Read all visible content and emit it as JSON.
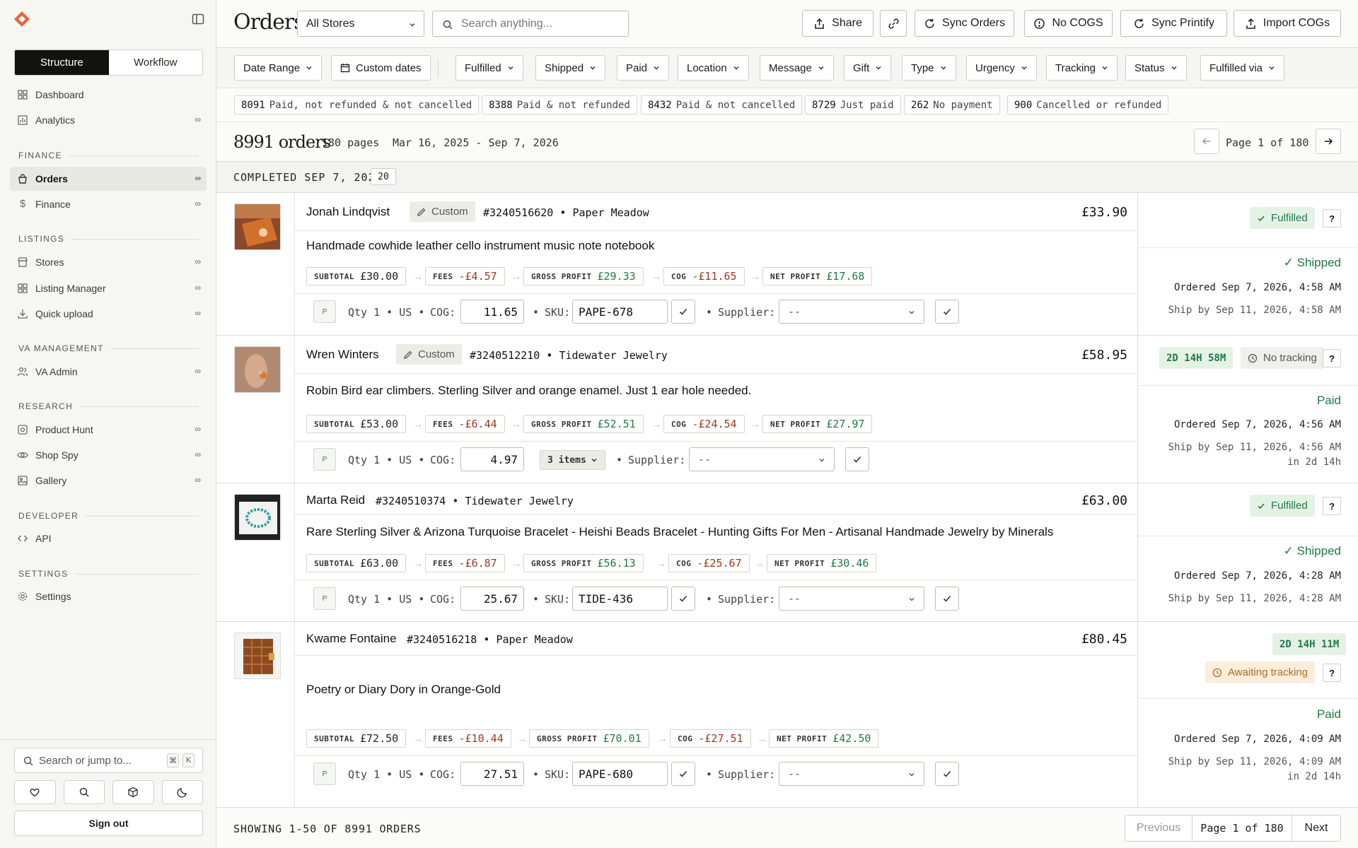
{
  "sidebar": {
    "tabs": [
      "Structure",
      "Workflow"
    ],
    "items": [
      {
        "label": "Dashboard"
      },
      {
        "label": "Analytics",
        "badge": "∞"
      },
      {
        "label": "Orders",
        "badge": "∞"
      },
      {
        "label": "Finance",
        "badge": "∞"
      },
      {
        "label": "Stores",
        "badge": "∞"
      },
      {
        "label": "Listing Manager",
        "badge": "∞"
      },
      {
        "label": "Quick upload",
        "badge": "∞"
      },
      {
        "label": "VA Admin",
        "badge": "∞"
      },
      {
        "label": "Product Hunt",
        "badge": "∞"
      },
      {
        "label": "Shop Spy",
        "badge": "∞"
      },
      {
        "label": "Gallery",
        "badge": "∞"
      },
      {
        "label": "API"
      },
      {
        "label": "Settings"
      }
    ],
    "sections": [
      "FINANCE",
      "LISTINGS",
      "VA MANAGEMENT",
      "RESEARCH",
      "DEVELOPER",
      "SETTINGS"
    ],
    "search_placeholder": "Search or jump to...",
    "kbd": [
      "⌘",
      "K"
    ],
    "sign_out": "Sign out"
  },
  "header": {
    "title": "Orders",
    "store_select": "All Stores",
    "search_placeholder": "Search anything...",
    "share": "Share",
    "sync_orders": "Sync Orders",
    "no_cogs": "No COGS",
    "sync_printify": "Sync Printify",
    "import_cogs": "Import COGs"
  },
  "filters": [
    "Date Range",
    "Custom dates",
    "Fulfilled",
    "Shipped",
    "Paid",
    "Location",
    "Message",
    "Gift",
    "Type",
    "Urgency",
    "Tracking",
    "Status",
    "Fulfilled via"
  ],
  "stats": [
    {
      "count": "8091",
      "label": "Paid, not refunded & not cancelled"
    },
    {
      "count": "8388",
      "label": "Paid & not refunded"
    },
    {
      "count": "8432",
      "label": "Paid & not cancelled"
    },
    {
      "count": "8729",
      "label": "Just paid"
    },
    {
      "count": "262",
      "label": "No payment"
    },
    {
      "count": "900",
      "label": "Cancelled or refunded"
    }
  ],
  "summary": {
    "orders": "8991 orders",
    "pages": "180 pages",
    "date_range": "Mar 16, 2025 - Sep 7, 2026",
    "page_label": "Page 1 of 180"
  },
  "group": {
    "label": "COMPLETED SEP 7, 2026",
    "count": "20"
  },
  "labels": {
    "subtotal": "SUBTOTAL",
    "fees": "FEES",
    "gross": "GROSS PROFIT",
    "cog": "COG",
    "net": "NET PROFIT",
    "cog_field": "COG:",
    "sku_field": "SKU:",
    "supplier_field": "Supplier:",
    "custom": "Custom",
    "question": "?"
  },
  "orders": [
    {
      "customer": "Jonah Lindqvist",
      "custom": true,
      "number": "#3240516620",
      "shop": "Paper Meadow",
      "price": "£33.90",
      "title": "Handmade cowhide leather cello instrument music note notebook",
      "subtotal": "£30.00",
      "fees": "-£4.57",
      "gross": "£29.33",
      "cog": "-£11.65",
      "net": "£17.68",
      "qty_line": "Qty 1 • US •",
      "cog_value": "11.65",
      "sku": "PAPE-678",
      "supplier": "--",
      "badge": "Fulfilled",
      "ship_state": "✓ Shipped",
      "ordered": "Ordered Sep 7, 2026, 4:58 AM",
      "ship_by": "Ship by Sep 11, 2026, 4:58 AM"
    },
    {
      "customer": "Wren Winters",
      "custom": true,
      "number": "#3240512210",
      "shop": "Tidewater Jewelry",
      "price": "£58.95",
      "title": "Robin Bird ear climbers. Sterling Silver and orange enamel. Just 1 ear hole needed.",
      "subtotal": "£53.00",
      "fees": "-£6.44",
      "gross": "£52.51",
      "cog": "-£24.54",
      "net": "£27.97",
      "qty_line": "Qty 1 • US •",
      "cog_value": "4.97",
      "items": "3 items",
      "supplier": "--",
      "timer": "2D 14H 58M",
      "badge": "No tracking",
      "ship_state": "Paid",
      "ordered": "Ordered Sep 7, 2026, 4:56 AM",
      "ship_by": "Ship by Sep 11, 2026, 4:56 AM",
      "ship_in": "in 2d 14h"
    },
    {
      "customer": "Marta Reid",
      "custom": false,
      "number": "#3240510374",
      "shop": "Tidewater Jewelry",
      "price": "£63.00",
      "title": "Rare Sterling Silver & Arizona Turquoise Bracelet - Heishi Beads Bracelet - Hunting Gifts For Men - Artisanal Handmade Jewelry by Minerals",
      "subtotal": "£63.00",
      "fees": "-£6.87",
      "gross": "£56.13",
      "cog": "-£25.67",
      "net": "£30.46",
      "qty_line": "Qty 1 • US •",
      "cog_value": "25.67",
      "sku": "TIDE-436",
      "supplier": "--",
      "badge": "Fulfilled",
      "ship_state": "✓ Shipped",
      "ordered": "Ordered Sep 7, 2026, 4:28 AM",
      "ship_by": "Ship by Sep 11, 2026, 4:28 AM"
    },
    {
      "customer": "Kwame Fontaine",
      "custom": false,
      "number": "#3240516218",
      "shop": "Paper Meadow",
      "price": "£80.45",
      "title": "Poetry or Diary Dory in Orange-Gold",
      "subtotal": "£72.50",
      "fees": "-£10.44",
      "gross": "£70.01",
      "cog": "-£27.51",
      "net": "£42.50",
      "qty_line": "Qty 1 • US •",
      "cog_value": "27.51",
      "sku": "PAPE-680",
      "supplier": "--",
      "timer": "2D 14H 11M",
      "badge": "Awaiting tracking",
      "ship_state": "Paid",
      "ordered": "Ordered Sep 7, 2026, 4:09 AM",
      "ship_by": "Ship by Sep 11, 2026, 4:09 AM",
      "ship_in": "in 2d 14h"
    }
  ],
  "footer": {
    "showing": "SHOWING 1-50 OF 8991 ORDERS",
    "previous": "Previous",
    "page": "Page 1 of 180",
    "next": "Next"
  },
  "colors": {
    "accent": "#e8663a",
    "positive": "#1f7a45",
    "negative": "#a0381e",
    "warning": "#b86a17"
  }
}
